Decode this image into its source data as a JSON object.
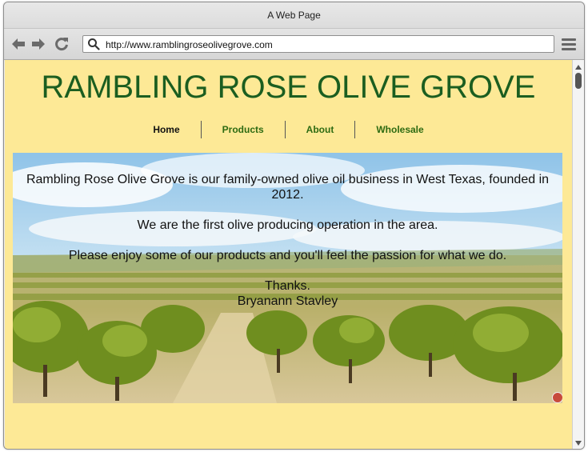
{
  "browser": {
    "window_title": "A Web Page",
    "url": "http://www.ramblingroseolivegrove.com",
    "icons": {
      "back": "back-arrow-icon",
      "forward": "forward-arrow-icon",
      "reload": "reload-icon",
      "search": "search-icon",
      "menu": "hamburger-menu-icon"
    }
  },
  "site": {
    "title": "RAMBLING ROSE OLIVE GROVE",
    "nav": {
      "home": "Home",
      "products": "Products",
      "about": "About",
      "wholesale": "Wholesale",
      "active": "Home"
    },
    "hero": {
      "line1": "Rambling Rose Olive Grove is our family-owned olive oil business in West Texas, founded in 2012.",
      "line2": "We are the first olive producing operation in the area.",
      "line3": "Please enjoy some of our products and you'll feel the passion for what we do.",
      "thanks": "Thanks.",
      "signature": "Bryanann Stavley"
    }
  },
  "colors": {
    "page_background": "#fde996",
    "title_green": "#1b5e20",
    "nav_green": "#2e6b12",
    "nav_active": "#111111"
  }
}
